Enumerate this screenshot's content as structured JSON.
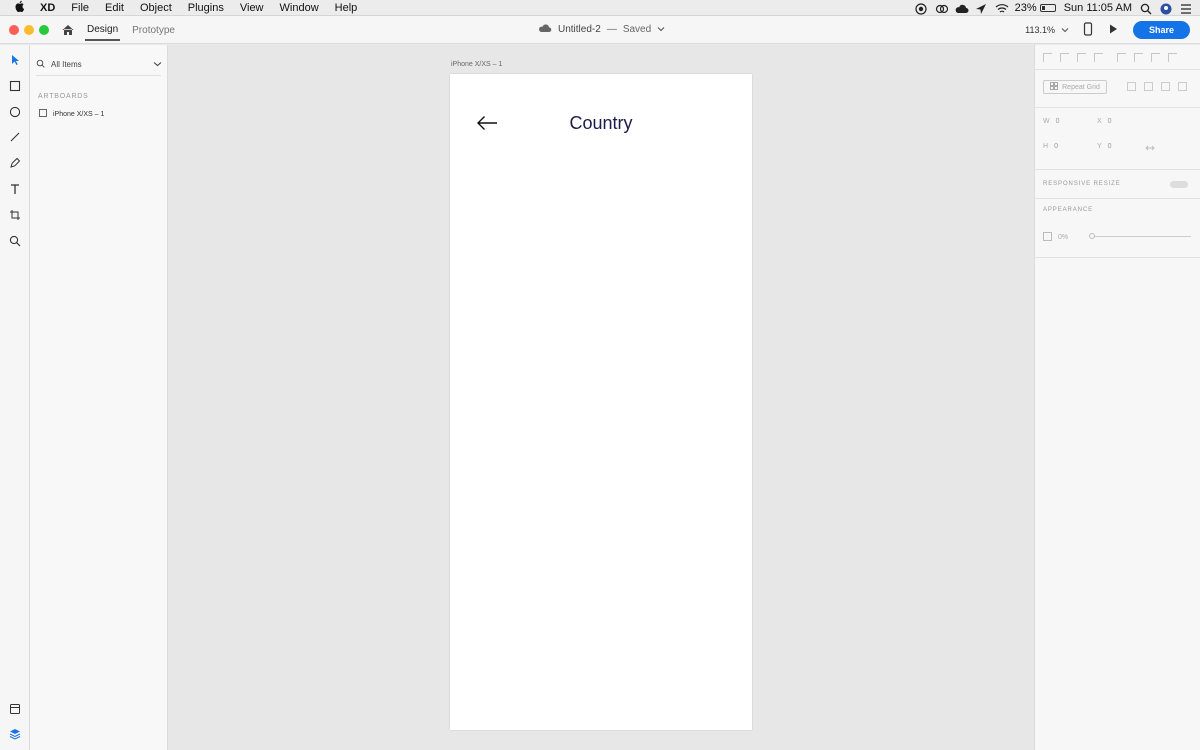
{
  "menubar": {
    "apple": "",
    "items": [
      "XD",
      "File",
      "Edit",
      "Object",
      "Plugins",
      "View",
      "Window",
      "Help"
    ],
    "battery_pct": "23%",
    "clock": "Sun 11:05 AM"
  },
  "titlebar": {
    "tabs": [
      "Design",
      "Prototype"
    ],
    "document_name": "Untitled-2",
    "save_separator": "—",
    "save_status": "Saved",
    "zoom": "113.1%",
    "share_label": "Share",
    "traffic_colors": [
      "#fc5f57",
      "#fdbc2e",
      "#28c841"
    ]
  },
  "layers": {
    "filter_label": "All Items",
    "section": "ARTBOARDS",
    "items": [
      "iPhone X/XS – 1"
    ]
  },
  "canvas": {
    "artboard_label": "iPhone X/XS – 1",
    "screen_title": "Country",
    "title_color": "#1c1c4a"
  },
  "props": {
    "repeat_grid": "Repeat Grid",
    "w_label": "W",
    "w_value": "0",
    "h_label": "H",
    "h_value": "0",
    "x_label": "X",
    "x_value": "0",
    "y_label": "Y",
    "y_value": "0",
    "responsive_resize": "RESPONSIVE RESIZE",
    "appearance": "APPEARANCE",
    "opacity": "0%"
  },
  "accent_color": "#1473e6"
}
